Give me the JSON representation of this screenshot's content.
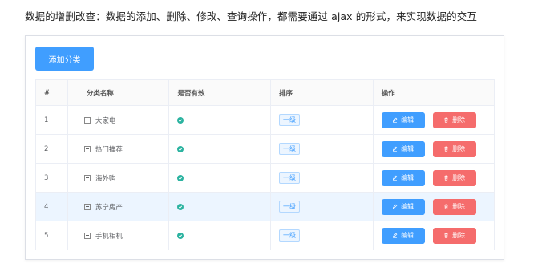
{
  "heading": "数据的增删改查：数据的添加、删除、修改、查询操作，都需要通过 ajax 的形式，来实现数据的交互",
  "toolbar": {
    "add_label": "添加分类"
  },
  "table": {
    "headers": {
      "index": "#",
      "name": "分类名称",
      "valid": "是否有效",
      "sort": "排序",
      "ops": "操作"
    },
    "rows": [
      {
        "index": "1",
        "name": "大家电",
        "level": "一级"
      },
      {
        "index": "2",
        "name": "热门推荐",
        "level": "一级"
      },
      {
        "index": "3",
        "name": "海外购",
        "level": "一级"
      },
      {
        "index": "4",
        "name": "苏宁房产",
        "level": "一级"
      },
      {
        "index": "5",
        "name": "手机相机",
        "level": "一级"
      }
    ],
    "edit_label": "编辑",
    "delete_label": "删除"
  },
  "colors": {
    "primary": "#409eff",
    "danger": "#f56c6c",
    "success": "#2bb3a0",
    "row_highlight": "#ecf5ff"
  }
}
